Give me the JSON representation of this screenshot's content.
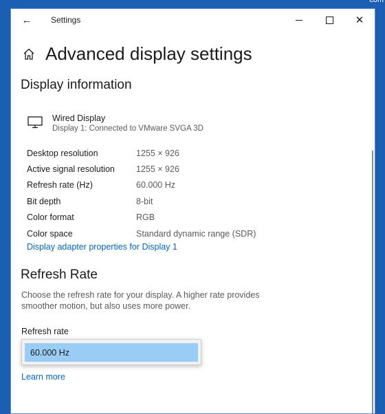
{
  "desktop": {
    "corner_text": "com"
  },
  "window": {
    "title": "Settings",
    "back_icon": "arrow-left-icon",
    "controls": {
      "minimize": "minimize-icon",
      "maximize": "maximize-icon",
      "close": "close-icon"
    }
  },
  "header": {
    "icon": "home-icon",
    "title": "Advanced display settings"
  },
  "display_information": {
    "title": "Display information",
    "device": {
      "icon": "monitor-icon",
      "name": "Wired Display",
      "subtitle": "Display 1: Connected to VMware SVGA 3D"
    },
    "rows": [
      {
        "label": "Desktop resolution",
        "value": "1255 × 926"
      },
      {
        "label": "Active signal resolution",
        "value": "1255 × 926"
      },
      {
        "label": "Refresh rate (Hz)",
        "value": "60.000 Hz"
      },
      {
        "label": "Bit depth",
        "value": "8-bit"
      },
      {
        "label": "Color format",
        "value": "RGB"
      },
      {
        "label": "Color space",
        "value": "Standard dynamic range (SDR)"
      }
    ],
    "adapter_link": "Display adapter properties for Display 1"
  },
  "refresh_rate": {
    "title": "Refresh Rate",
    "description": "Choose the refresh rate for your display. A higher rate provides smoother motion, but also uses more power.",
    "dropdown_label": "Refresh rate",
    "options": [
      "60.000 Hz"
    ],
    "selected": "60.000 Hz",
    "learn_more": "Learn more"
  },
  "colors": {
    "accent": "#0067c0",
    "selection": "#99cdf5",
    "desktop": "#1a5fb4"
  }
}
